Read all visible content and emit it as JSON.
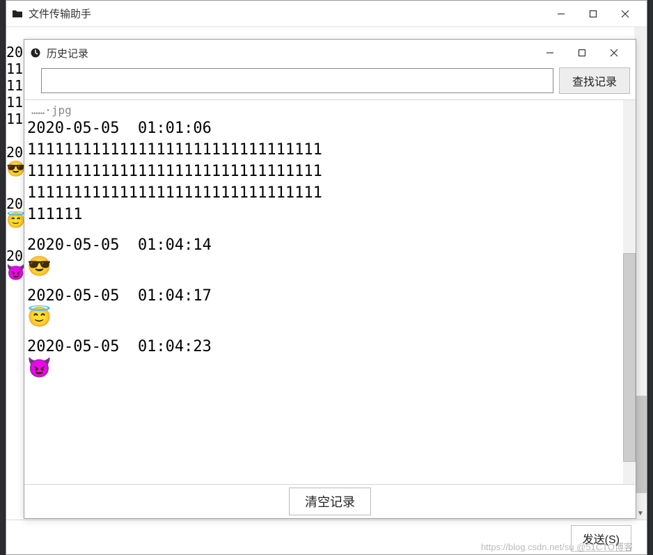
{
  "parent": {
    "title": "文件传输助手",
    "send_label": "发送(S)"
  },
  "bg": {
    "line1_ts_frag": "20",
    "line2": "11",
    "line3": "11",
    "line4": "11",
    "line5": "11",
    "ts2_frag": "20",
    "emoji2": "😎",
    "ts3_frag": "20",
    "emoji3": "😇",
    "ts4_frag": "20",
    "emoji4": "😈"
  },
  "history": {
    "title": "历史记录",
    "search_placeholder": "",
    "search_btn": "查找记录",
    "clear_btn": "清空记录",
    "top_fragment": "……·jpg",
    "entries": [
      {
        "ts": "2020-05-05  01:01:06",
        "body": "111111111111111111111111111111111111111111111111111111111111111111111111111111111111111111111111111111",
        "is_emoji": false
      },
      {
        "ts": "2020-05-05  01:04:14",
        "body": "😎",
        "is_emoji": true
      },
      {
        "ts": "2020-05-05  01:04:17",
        "body": "😇",
        "is_emoji": true
      },
      {
        "ts": "2020-05-05  01:04:23",
        "body": "😈",
        "is_emoji": true
      }
    ]
  },
  "watermark": "https://blog.csdn.net/su  @51CTO博客"
}
